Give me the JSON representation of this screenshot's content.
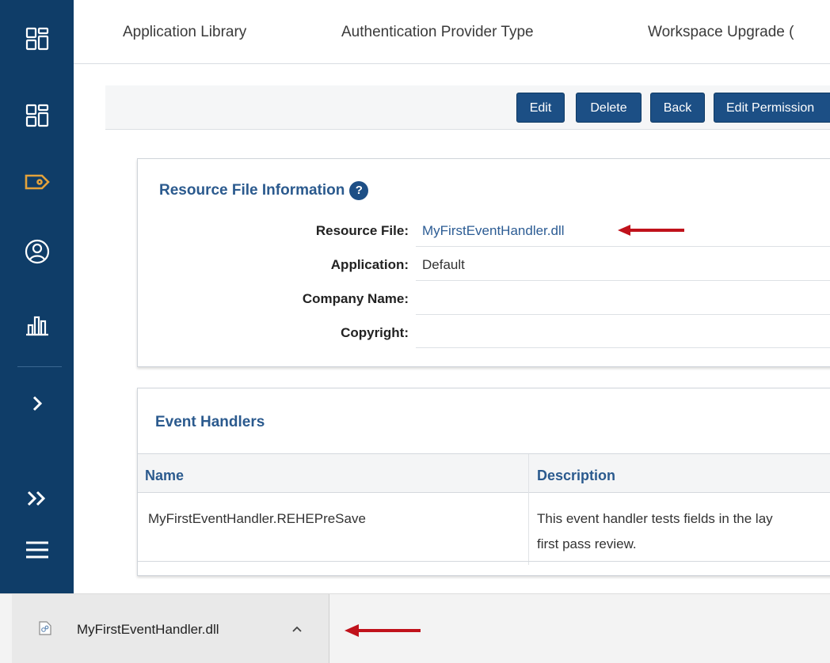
{
  "topnav": {
    "tabs": [
      {
        "label": "Application Library"
      },
      {
        "label": "Authentication Provider Type"
      },
      {
        "label": "Workspace Upgrade ("
      }
    ]
  },
  "toolbar": {
    "edit_label": "Edit",
    "delete_label": "Delete",
    "back_label": "Back",
    "edit_permissions_label": "Edit Permission"
  },
  "resource_panel": {
    "title": "Resource File Information",
    "help_glyph": "?",
    "fields": [
      {
        "label": "Resource File:",
        "value": "MyFirstEventHandler.dll"
      },
      {
        "label": "Application:",
        "value": "Default"
      },
      {
        "label": "Company Name:",
        "value": ""
      },
      {
        "label": "Copyright:",
        "value": ""
      }
    ]
  },
  "event_handlers_panel": {
    "title": "Event Handlers",
    "columns": [
      "Name",
      "Description"
    ],
    "rows": [
      {
        "name": "MyFirstEventHandler.REHEPreSave",
        "description_line1": "This event handler tests fields in the lay",
        "description_line2": "first pass review."
      }
    ]
  },
  "download_bar": {
    "filename": "MyFirstEventHandler.dll"
  },
  "icons": {
    "sidebar": [
      "dashboard-icon",
      "workspace-icon",
      "tag-icon",
      "user-icon",
      "reports-icon",
      "chevron-right-icon",
      "double-chevron-icon",
      "menu-icon"
    ]
  },
  "colors": {
    "sidebar": "#0f3d68",
    "button": "#1c4f85",
    "link": "#2c5c94",
    "tag_accent": "#e3a23b",
    "annotation_arrow": "#c0121b"
  }
}
